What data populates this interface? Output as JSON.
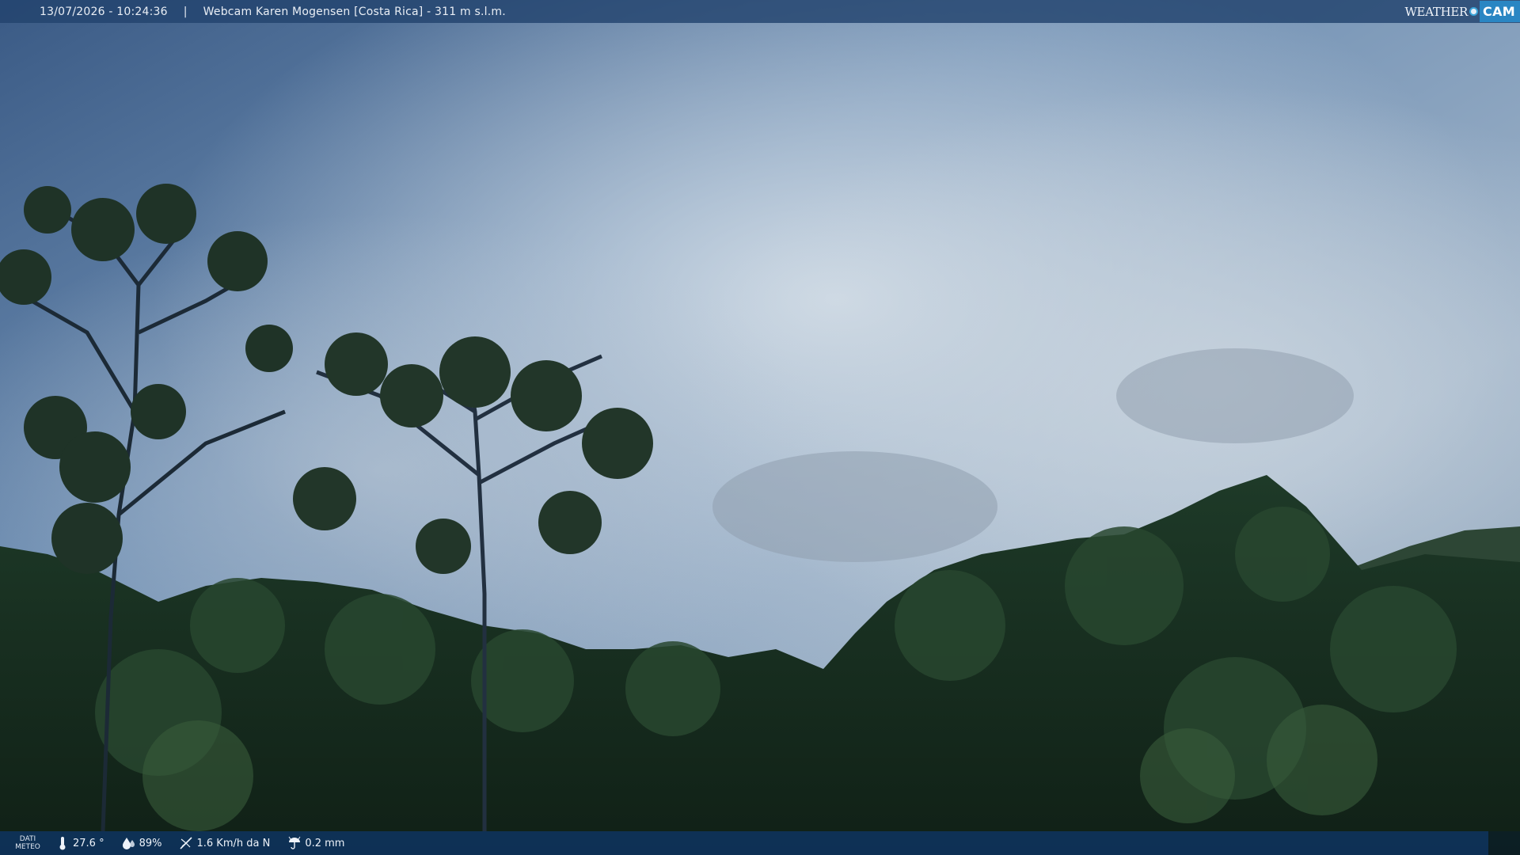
{
  "top_bar": {
    "datetime": "13/07/2026 - 10:24:36",
    "separator": "|",
    "title": "Webcam Karen Mogensen [Costa Rica] - 311 m s.l.m."
  },
  "brand": {
    "part_a": "WEATHER",
    "part_b": "CAM"
  },
  "bottom_bar": {
    "label_line1": "DATI",
    "label_line2": "METEO",
    "temperature": "27.6 °",
    "humidity": "89%",
    "wind": "1.6 Km/h da N",
    "rain": "0.2 mm"
  },
  "icons": {
    "temperature": "thermometer-icon",
    "humidity": "humidity-drop-icon",
    "wind": "wind-icon",
    "rain": "rain-icon"
  }
}
